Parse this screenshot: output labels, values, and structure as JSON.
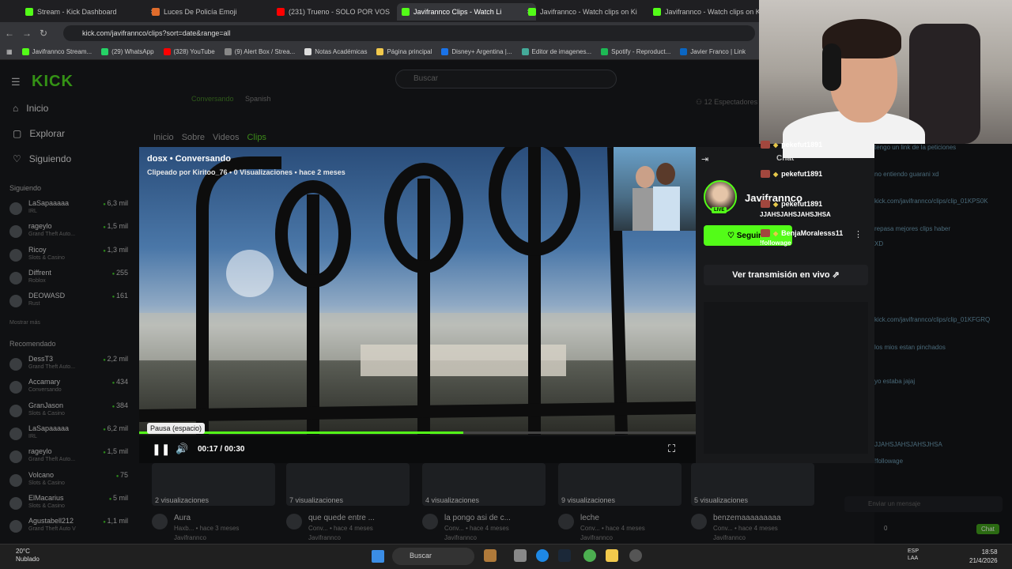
{
  "browser": {
    "tabs": [
      {
        "title": "Stream - Kick Dashboard",
        "color": "#53fc18"
      },
      {
        "title": "Luces De Policía Emoji",
        "color": "#e06c2c"
      },
      {
        "title": "(231) Trueno - SOLO POR VOS",
        "color": "#ff0000"
      },
      {
        "title": "Javifrannco Clips - Watch Li",
        "color": "#53fc18"
      },
      {
        "title": "Javifrannco - Watch clips on Ki",
        "color": "#53fc18"
      },
      {
        "title": "Javifrannco - Watch clips on Ki",
        "color": "#53fc18"
      }
    ],
    "url": "kick.com/javifrannco/clips?sort=date&range=all",
    "bookmarks": [
      "Javifrannco Stream...",
      "(29) WhatsApp",
      "(328) YouTube",
      "(9) Alert Box / Strea...",
      "Notas Académicas",
      "Página principal",
      "Disney+ Argentina |...",
      "Editor de imagenes...",
      "Spotify - Reproduct...",
      "Javier Franco | Link"
    ]
  },
  "kick": {
    "logo": "KICK",
    "search_placeholder": "Buscar",
    "nav": [
      "Inicio",
      "Explorar",
      "Siguiendo"
    ],
    "following_title": "Siguiendo",
    "following": [
      {
        "name": "LaSapaaaaa",
        "sub": "IRL",
        "viewers": "6,3 mil"
      },
      {
        "name": "rageylo",
        "sub": "Grand Theft Auto...",
        "viewers": "1,5 mil"
      },
      {
        "name": "Ricoy",
        "sub": "Slots & Casino",
        "viewers": "1,3 mil"
      },
      {
        "name": "Diffrent",
        "sub": "Roblox",
        "viewers": "255"
      },
      {
        "name": "DEOWASD",
        "sub": "Rust",
        "viewers": "161"
      }
    ],
    "show_more": "Mostrar más",
    "recommended_title": "Recomendado",
    "recommended": [
      {
        "name": "DessT3",
        "sub": "Grand Theft Auto...",
        "viewers": "2,2 mil"
      },
      {
        "name": "Accamary",
        "sub": "Conversando",
        "viewers": "434"
      },
      {
        "name": "GranJason",
        "sub": "Slots & Casino",
        "viewers": "384"
      },
      {
        "name": "LaSapaaaaa",
        "sub": "IRL",
        "viewers": "6,2 mil"
      },
      {
        "name": "rageylo",
        "sub": "Grand Theft Auto...",
        "viewers": "1,5 mil"
      },
      {
        "name": "Volcano",
        "sub": "Slots & Casino",
        "viewers": "75"
      },
      {
        "name": "ElMacarius",
        "sub": "Slots & Casino",
        "viewers": "5 mil"
      },
      {
        "name": "Agustabell212",
        "sub": "Grand Theft Auto V",
        "viewers": "1,1 mil"
      }
    ],
    "channel_tags": [
      "Conversando",
      "Spanish"
    ],
    "spectators": "12 Espectadores",
    "channel_tabs": [
      "Inicio",
      "Sobre",
      "Videos",
      "Clips"
    ]
  },
  "clip": {
    "title": "dosx • Conversando",
    "subtitle": "Clipeado por Kiritoo_76 • 0 Visualizaciones • hace 2 meses",
    "tooltip": "Pausa (espacio)",
    "time": "00:17 / 00:30",
    "progress": 0.583
  },
  "panel": {
    "chat_label": "Chat",
    "channel": "Javifrannco",
    "live": "LIVE",
    "follow": "Seguir",
    "watch_live": "Ver transmisión en vivo"
  },
  "overlay_chat": [
    {
      "user": "pekefut1891"
    },
    {
      "user": "pekefut1891"
    },
    {
      "user": "pekefut1891",
      "msg": "JJAHSJAHSJAHSJHSA"
    },
    {
      "user": "BenjaMoralesss11",
      "msg": "!followage"
    }
  ],
  "side_chat": [
    "tengo un link de la peticiones",
    "no entiendo guarani xd",
    "kick.com/javifrannco/clips/clip_01KPS0K",
    "repasa mejores clips haber",
    "XD",
    "kick.com/javifrannco/clips/clip_01KFGRQ",
    "los mios estan pinchados",
    "yo estaba jajaj",
    "JJAHSJAHSJAHSJHSA",
    "!followage"
  ],
  "chat_input_placeholder": "Enviar un mensaje",
  "chat_send": "Chat",
  "chat_count": "0",
  "clips": [
    {
      "views": "2 visualizaciones",
      "title": "Aura",
      "sub": "Haxb... • hace 3 meses",
      "author": "Javifrannco"
    },
    {
      "views": "7 visualizaciones",
      "title": "que quede entre ...",
      "sub": "Conv... • hace 4 meses",
      "author": "Javifrannco"
    },
    {
      "views": "4 visualizaciones",
      "title": "la pongo asi de c...",
      "sub": "Conv... • hace 4 meses",
      "author": "Javifrannco"
    },
    {
      "views": "9 visualizaciones",
      "title": "leche",
      "sub": "Conv... • hace 4 meses",
      "author": "Javifrannco"
    },
    {
      "views": "5 visualizaciones",
      "title": "benzemaaaaaaaaa",
      "sub": "Conv... • hace 4 meses",
      "author": "Javifrannco"
    }
  ],
  "taskbar": {
    "temp": "20°C",
    "weather": "Nublado",
    "search": "Buscar",
    "lang1": "ESP",
    "lang2": "LAA",
    "time": "18:58",
    "date": "21/4/2026"
  }
}
